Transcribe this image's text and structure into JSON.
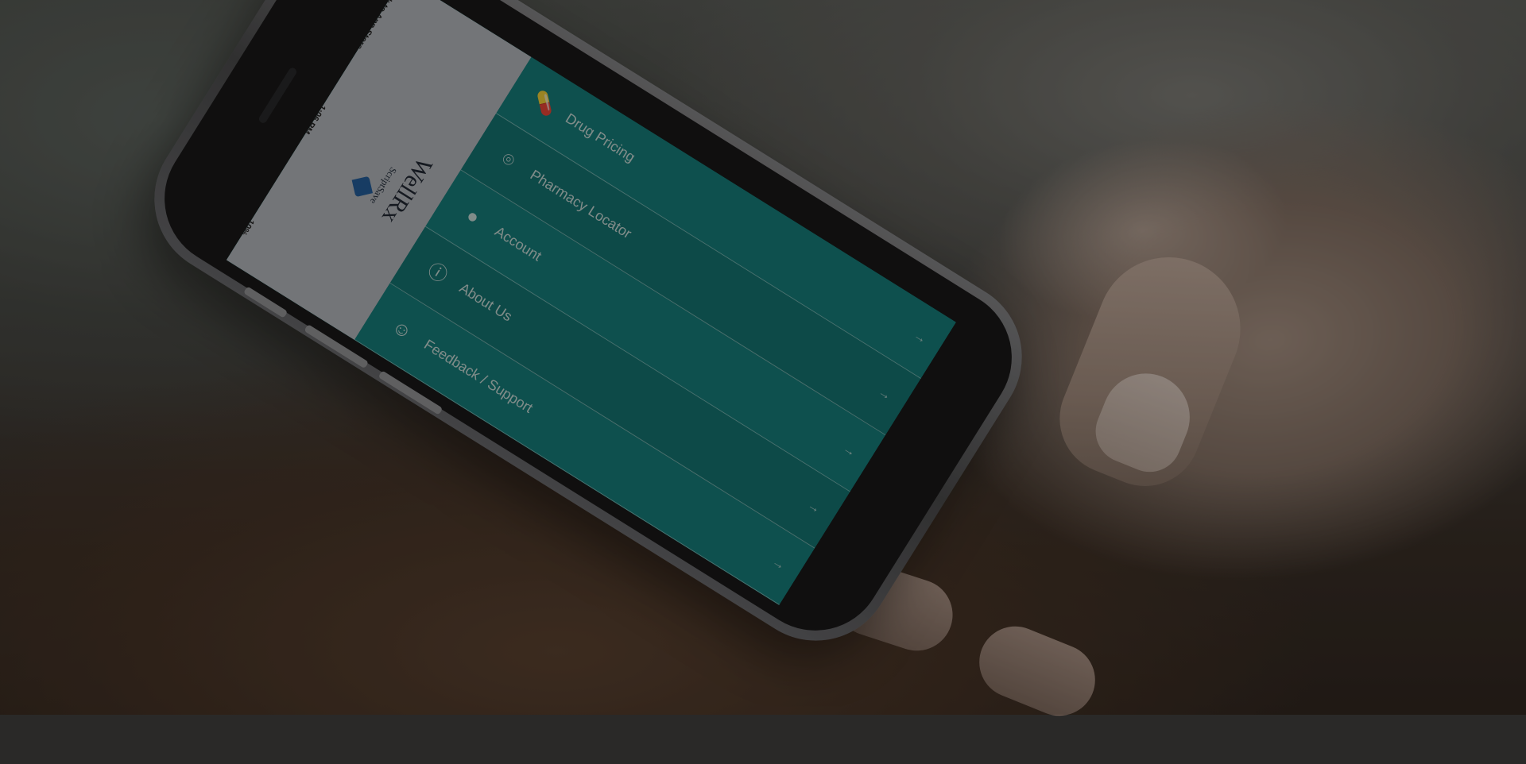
{
  "status_bar": {
    "back_label": "◂Back to App Store",
    "time": "1:06 PM",
    "battery": "10%"
  },
  "brand": {
    "script_label": "ScriptSave",
    "name": "WellRx",
    "accent_color": "#0f7d7b"
  },
  "menu": {
    "items": [
      {
        "label": "Drug Pricing",
        "icon": "pill-icon"
      },
      {
        "label": "Pharmacy Locator",
        "icon": "location-pin-icon"
      },
      {
        "label": "Account",
        "icon": "user-icon"
      },
      {
        "label": "About Us",
        "icon": "info-icon"
      },
      {
        "label": "Feedback / Support",
        "icon": "chat-icon"
      }
    ]
  }
}
